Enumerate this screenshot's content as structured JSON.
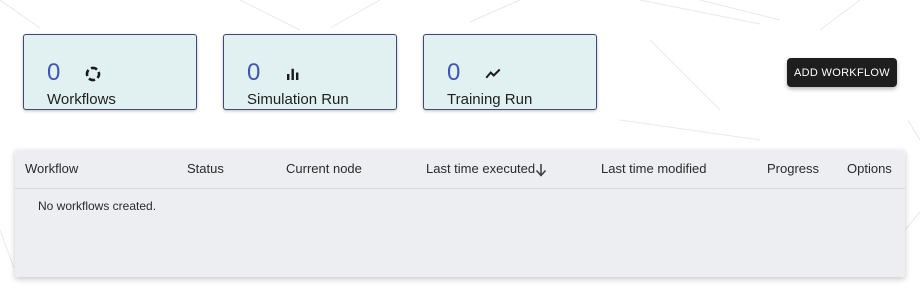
{
  "stats": [
    {
      "count": "0",
      "label": "Workflows",
      "icon": "spinner-ring-icon"
    },
    {
      "count": "0",
      "label": "Simulation Run",
      "icon": "bar-chart-icon"
    },
    {
      "count": "0",
      "label": "Training Run",
      "icon": "trending-line-icon"
    }
  ],
  "actions": {
    "add_workflow_label": "ADD WORKFLOW"
  },
  "table": {
    "columns": [
      "Workflow",
      "Status",
      "Current node",
      "Last time executed",
      "Last time modified",
      "Progress",
      "Options"
    ],
    "sorted_column": "Last time executed",
    "sort_direction": "descending",
    "sort_icon": "arrow-down-icon",
    "empty_message": "No workflows created."
  },
  "colors": {
    "card_background": "#e1f1f1",
    "card_border": "#3d4a78",
    "count_color": "#3d55b4",
    "button_background": "#1e1e1e",
    "table_background": "#eceef1"
  }
}
